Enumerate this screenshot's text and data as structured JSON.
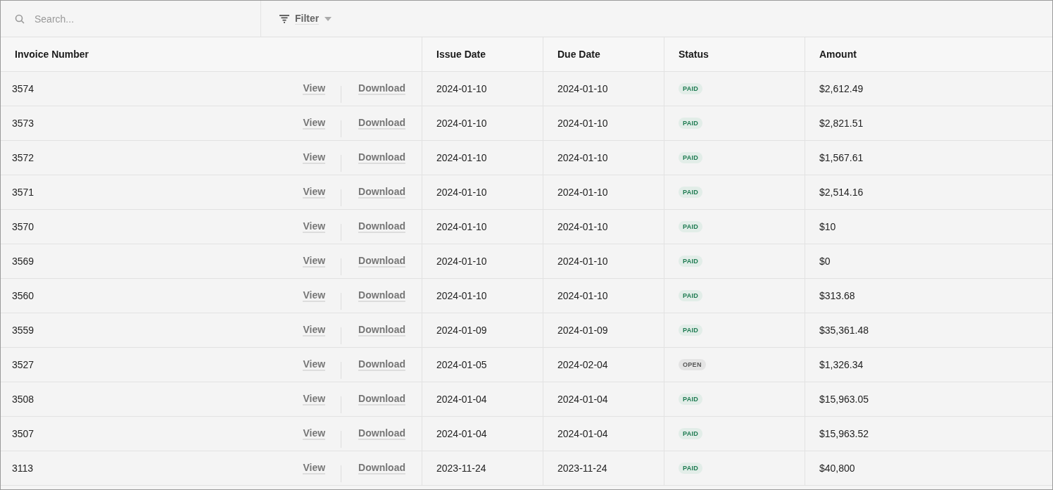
{
  "toolbar": {
    "search": {
      "placeholder": "Search..."
    },
    "filter": {
      "label": "Filter"
    }
  },
  "table": {
    "columns": [
      "Invoice Number",
      "Issue Date",
      "Due Date",
      "Status",
      "Amount"
    ],
    "rows": [
      {
        "number": "3574",
        "view": "View",
        "download": "Download",
        "issue": "2024-01-10",
        "due": "2024-01-10",
        "status": {
          "label": "PAID",
          "kind": "paid"
        },
        "amount": "$2,612.49"
      },
      {
        "number": "3573",
        "view": "View",
        "download": "Download",
        "issue": "2024-01-10",
        "due": "2024-01-10",
        "status": {
          "label": "PAID",
          "kind": "paid"
        },
        "amount": "$2,821.51"
      },
      {
        "number": "3572",
        "view": "View",
        "download": "Download",
        "issue": "2024-01-10",
        "due": "2024-01-10",
        "status": {
          "label": "PAID",
          "kind": "paid"
        },
        "amount": "$1,567.61"
      },
      {
        "number": "3571",
        "view": "View",
        "download": "Download",
        "issue": "2024-01-10",
        "due": "2024-01-10",
        "status": {
          "label": "PAID",
          "kind": "paid"
        },
        "amount": "$2,514.16"
      },
      {
        "number": "3570",
        "view": "View",
        "download": "Download",
        "issue": "2024-01-10",
        "due": "2024-01-10",
        "status": {
          "label": "PAID",
          "kind": "paid"
        },
        "amount": "$10"
      },
      {
        "number": "3569",
        "view": "View",
        "download": "Download",
        "issue": "2024-01-10",
        "due": "2024-01-10",
        "status": {
          "label": "PAID",
          "kind": "paid"
        },
        "amount": "$0"
      },
      {
        "number": "3560",
        "view": "View",
        "download": "Download",
        "issue": "2024-01-10",
        "due": "2024-01-10",
        "status": {
          "label": "PAID",
          "kind": "paid"
        },
        "amount": "$313.68"
      },
      {
        "number": "3559",
        "view": "View",
        "download": "Download",
        "issue": "2024-01-09",
        "due": "2024-01-09",
        "status": {
          "label": "PAID",
          "kind": "paid"
        },
        "amount": "$35,361.48"
      },
      {
        "number": "3527",
        "view": "View",
        "download": "Download",
        "issue": "2024-01-05",
        "due": "2024-02-04",
        "status": {
          "label": "OPEN",
          "kind": "open"
        },
        "amount": "$1,326.34"
      },
      {
        "number": "3508",
        "view": "View",
        "download": "Download",
        "issue": "2024-01-04",
        "due": "2024-01-04",
        "status": {
          "label": "PAID",
          "kind": "paid"
        },
        "amount": "$15,963.05"
      },
      {
        "number": "3507",
        "view": "View",
        "download": "Download",
        "issue": "2024-01-04",
        "due": "2024-01-04",
        "status": {
          "label": "PAID",
          "kind": "paid"
        },
        "amount": "$15,963.52"
      },
      {
        "number": "3113",
        "view": "View",
        "download": "Download",
        "issue": "2023-11-24",
        "due": "2023-11-24",
        "status": {
          "label": "PAID",
          "kind": "paid"
        },
        "amount": "$40,800"
      }
    ]
  }
}
